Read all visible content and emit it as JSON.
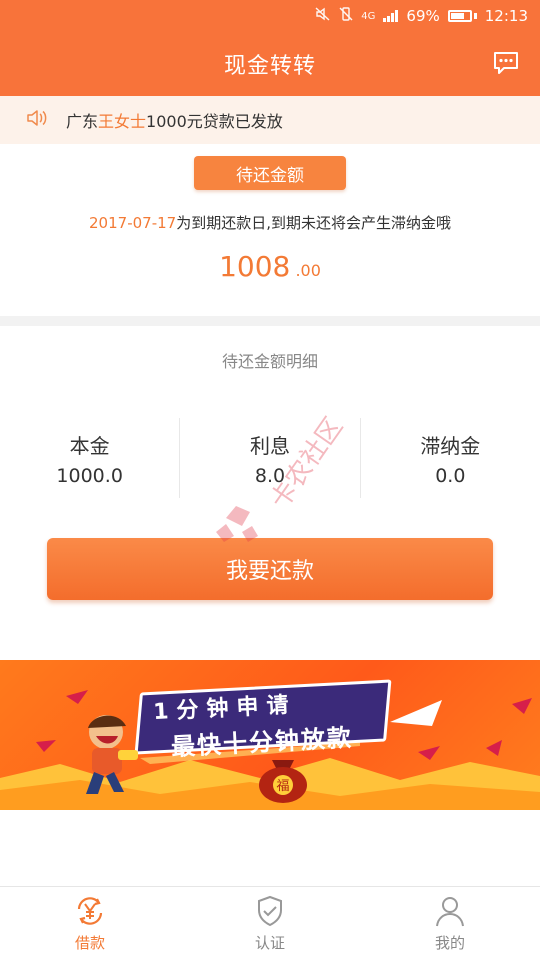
{
  "status_bar": {
    "network": "4G",
    "battery": "69%",
    "time": "12:13"
  },
  "header": {
    "title": "现金转转"
  },
  "notice": {
    "prefix": "广东",
    "highlight": "王女士",
    "suffix": "1000元贷款已发放"
  },
  "amount_due": {
    "tag": "待还金额",
    "due_date": "2017-07-17",
    "due_text": "为到期还款日,到期未还将会产生滞纳金哦",
    "amount_int": "1008",
    "amount_dec": ".00"
  },
  "details": {
    "title": "待还金额明细",
    "columns": [
      {
        "label": "本金",
        "value": "1000.0"
      },
      {
        "label": "利息",
        "value": "8.0"
      },
      {
        "label": "滞纳金",
        "value": "0.0"
      }
    ],
    "repay_button": "我要还款"
  },
  "banner": {
    "line1": "1分钟申请",
    "line2": "最快十分钟放款",
    "bag_char": "福"
  },
  "watermark": {
    "text": "卡农社区"
  },
  "tabs": [
    {
      "label": "借款",
      "icon": "loan-yen-icon",
      "active": true
    },
    {
      "label": "认证",
      "icon": "shield-check-icon",
      "active": false
    },
    {
      "label": "我的",
      "icon": "person-icon",
      "active": false
    }
  ],
  "colors": {
    "brand": "#f8733a",
    "accent_text": "#f37a35",
    "notice_bg": "#fdf2ea"
  }
}
